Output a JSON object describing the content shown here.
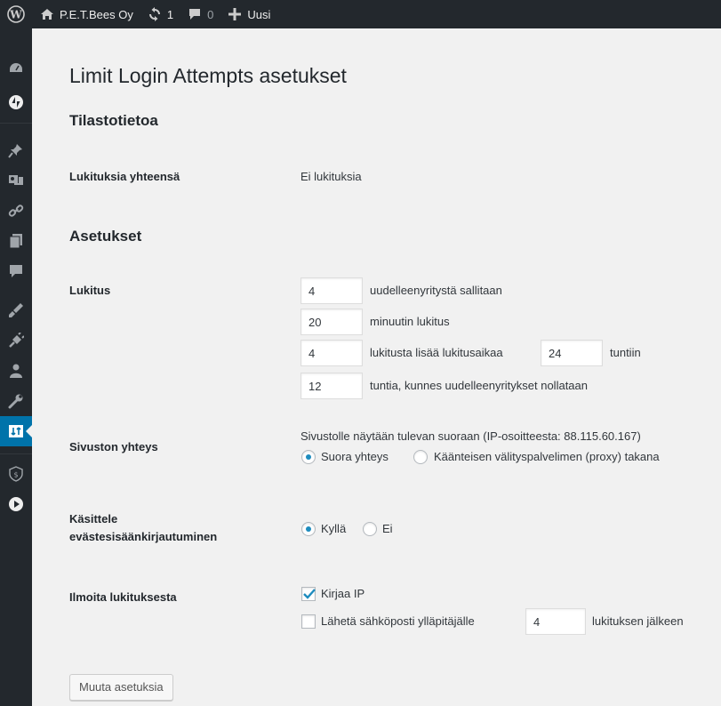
{
  "admin_bar": {
    "site_name": "P.E.T.Bees Oy",
    "updates_count": "1",
    "comments_count": "0",
    "new_label": "Uusi"
  },
  "side_menu": {
    "icons": [
      "dashboard-icon",
      "jetpack-icon",
      "pin-icon",
      "media-icon",
      "link-icon",
      "pages-icon",
      "comments-icon",
      "appearance-icon",
      "plugins-icon",
      "users-icon",
      "tools-icon",
      "settings-icon",
      "security-icon",
      "play-icon"
    ]
  },
  "page": {
    "title": "Limit Login Attempts asetukset",
    "stats_heading": "Tilastotietoa",
    "total_lockouts_label": "Lukituksia yhteensä",
    "total_lockouts_value": "Ei lukituksia",
    "settings_heading": "Asetukset",
    "lockout": {
      "label": "Lukitus",
      "allowed_retries": "4",
      "allowed_retries_text": "uudelleenyritystä sallitaan",
      "lockout_minutes": "20",
      "lockout_minutes_text": "minuutin lukitus",
      "lockouts_increase": "4",
      "lockouts_increase_text": "lukitusta lisää lukitusaikaa",
      "increase_hours": "24",
      "increase_hours_text": "tuntiin",
      "reset_hours": "12",
      "reset_hours_text": "tuntia, kunnes uudelleenyritykset nollataan"
    },
    "connection": {
      "label": "Sivuston yhteys",
      "description": "Sivustolle näytään tulevan suoraan (IP-osoitteesta: 88.115.60.167)",
      "option_direct": "Suora yhteys",
      "option_proxy": "Käänteisen välityspalvelimen (proxy) takana",
      "selected": "direct"
    },
    "cookies": {
      "label_line1": "Käsittele",
      "label_line2": "evästesisäänkirjautuminen",
      "option_yes": "Kyllä",
      "option_no": "Ei",
      "selected": "yes"
    },
    "notify": {
      "label": "Ilmoita lukituksesta",
      "log_ip_label": "Kirjaa IP",
      "log_ip_checked": true,
      "email_label": "Lähetä sähköposti ylläpitäjälle",
      "email_checked": false,
      "email_after": "4",
      "email_after_text": "lukituksen jälkeen"
    },
    "submit_label": "Muuta asetuksia"
  },
  "colors": {
    "admin_bar_bg": "#23282d",
    "menu_current": "#0073aa",
    "radio_dot": "#1e8cbe",
    "page_bg": "#f1f1f1"
  }
}
